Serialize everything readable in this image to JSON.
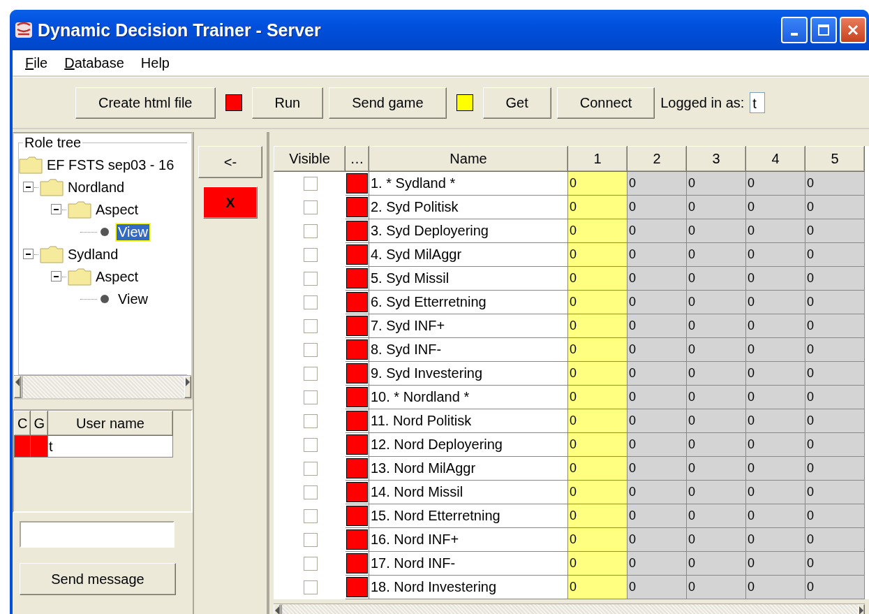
{
  "window": {
    "title": "Dynamic Decision Trainer - Server"
  },
  "menu": [
    {
      "label": "File",
      "underline_first": true
    },
    {
      "label": "Database",
      "underline_first": true
    },
    {
      "label": "Help",
      "underline_first": false
    }
  ],
  "toolbar": [
    {
      "kind": "button",
      "label": "Create html file"
    },
    {
      "kind": "indicator",
      "color": "#ff0000"
    },
    {
      "kind": "button",
      "label": "Run"
    },
    {
      "kind": "button",
      "label": "Send game"
    },
    {
      "kind": "indicator",
      "color": "#ffff00"
    },
    {
      "kind": "button",
      "label": "Get"
    },
    {
      "kind": "button",
      "label": "Connect"
    },
    {
      "kind": "label",
      "label": "Logged in as:"
    },
    {
      "kind": "field",
      "value": "t"
    }
  ],
  "role_tree": {
    "title": "Role tree",
    "items": [
      {
        "label": "EF FSTS sep03 - 16",
        "kind": "folder",
        "selected": false,
        "children": [
          {
            "label": "Nordland",
            "kind": "folder",
            "expanded": true,
            "selected": false,
            "children": [
              {
                "label": "Aspect",
                "kind": "folder",
                "expanded": true,
                "selected": false,
                "children": [
                  {
                    "label": "View",
                    "kind": "leaf",
                    "selected": true
                  }
                ]
              }
            ]
          },
          {
            "label": "Sydland",
            "kind": "folder",
            "expanded": true,
            "selected": false,
            "children": [
              {
                "label": "Aspect",
                "kind": "folder",
                "expanded": true,
                "selected": false,
                "children": [
                  {
                    "label": "View",
                    "kind": "leaf",
                    "selected": false
                  }
                ]
              }
            ]
          }
        ]
      }
    ]
  },
  "users": {
    "columns": [
      "C",
      "G",
      "User name"
    ],
    "rows": [
      {
        "statuses": [
          {
            "color": "#ff0000"
          },
          {
            "color": "#ff0000"
          }
        ],
        "name": "t"
      }
    ]
  },
  "message": {
    "button": "Send message"
  },
  "middle_buttons": [
    {
      "label": "<-",
      "color": "#ece9d8"
    },
    {
      "label": "X",
      "color": "#ff0000"
    }
  ],
  "table": {
    "columns": [
      {
        "label": "Visible",
        "kind": "check",
        "selected": false
      },
      {
        "label": "…",
        "kind": "color",
        "selected": false
      },
      {
        "label": "Name",
        "kind": "text",
        "selected": false
      },
      {
        "label": "1",
        "kind": "value",
        "selected": true
      },
      {
        "label": "2",
        "kind": "value",
        "selected": false
      },
      {
        "label": "3",
        "kind": "value",
        "selected": false
      },
      {
        "label": "4",
        "kind": "value",
        "selected": false
      },
      {
        "label": "5",
        "kind": "value",
        "selected": false
      }
    ],
    "rows": [
      {
        "visible": false,
        "color": "#ff0000",
        "name": "1. * Sydland *",
        "values": [
          "0",
          "0",
          "0",
          "0",
          "0"
        ]
      },
      {
        "visible": false,
        "color": "#ff0000",
        "name": "2. Syd Politisk",
        "values": [
          "0",
          "0",
          "0",
          "0",
          "0"
        ]
      },
      {
        "visible": false,
        "color": "#ff0000",
        "name": "3. Syd Deployering",
        "values": [
          "0",
          "0",
          "0",
          "0",
          "0"
        ]
      },
      {
        "visible": false,
        "color": "#ff0000",
        "name": "4. Syd MilAggr",
        "values": [
          "0",
          "0",
          "0",
          "0",
          "0"
        ]
      },
      {
        "visible": false,
        "color": "#ff0000",
        "name": "5. Syd Missil",
        "values": [
          "0",
          "0",
          "0",
          "0",
          "0"
        ]
      },
      {
        "visible": false,
        "color": "#ff0000",
        "name": "6. Syd Etterretning",
        "values": [
          "0",
          "0",
          "0",
          "0",
          "0"
        ]
      },
      {
        "visible": false,
        "color": "#ff0000",
        "name": "7. Syd INF+",
        "values": [
          "0",
          "0",
          "0",
          "0",
          "0"
        ]
      },
      {
        "visible": false,
        "color": "#ff0000",
        "name": "8. Syd INF-",
        "values": [
          "0",
          "0",
          "0",
          "0",
          "0"
        ]
      },
      {
        "visible": false,
        "color": "#ff0000",
        "name": "9. Syd Investering",
        "values": [
          "0",
          "0",
          "0",
          "0",
          "0"
        ]
      },
      {
        "visible": false,
        "color": "#ff0000",
        "name": "10. * Nordland *",
        "values": [
          "0",
          "0",
          "0",
          "0",
          "0"
        ]
      },
      {
        "visible": false,
        "color": "#ff0000",
        "name": "11. Nord Politisk",
        "values": [
          "0",
          "0",
          "0",
          "0",
          "0"
        ]
      },
      {
        "visible": false,
        "color": "#ff0000",
        "name": "12. Nord Deployering",
        "values": [
          "0",
          "0",
          "0",
          "0",
          "0"
        ]
      },
      {
        "visible": false,
        "color": "#ff0000",
        "name": "13. Nord MilAggr",
        "values": [
          "0",
          "0",
          "0",
          "0",
          "0"
        ]
      },
      {
        "visible": false,
        "color": "#ff0000",
        "name": "14. Nord Missil",
        "values": [
          "0",
          "0",
          "0",
          "0",
          "0"
        ]
      },
      {
        "visible": false,
        "color": "#ff0000",
        "name": "15. Nord Etterretning",
        "values": [
          "0",
          "0",
          "0",
          "0",
          "0"
        ]
      },
      {
        "visible": false,
        "color": "#ff0000",
        "name": "16. Nord INF+",
        "values": [
          "0",
          "0",
          "0",
          "0",
          "0"
        ]
      },
      {
        "visible": false,
        "color": "#ff0000",
        "name": "17. Nord INF-",
        "values": [
          "0",
          "0",
          "0",
          "0",
          "0"
        ]
      },
      {
        "visible": false,
        "color": "#ff0000",
        "name": "18. Nord Investering",
        "values": [
          "0",
          "0",
          "0",
          "0",
          "0"
        ]
      }
    ]
  }
}
